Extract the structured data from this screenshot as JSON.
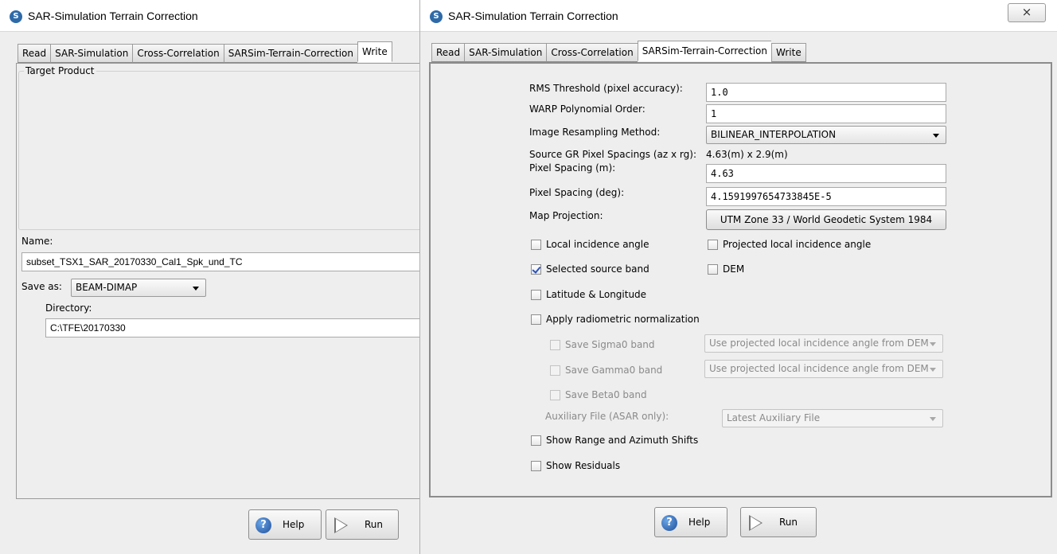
{
  "left_window": {
    "title": "SAR-Simulation Terrain Correction",
    "tabs": [
      "Read",
      "SAR-Simulation",
      "Cross-Correlation",
      "SARSim-Terrain-Correction",
      "Write"
    ],
    "active_tab": "Write",
    "group_title": "Target Product",
    "name_label": "Name:",
    "name_value": "subset_TSX1_SAR_20170330_Cal1_Spk_und_TC",
    "save_as_label": "Save as:",
    "save_as_value": "BEAM-DIMAP",
    "directory_label": "Directory:",
    "directory_value": "C:\\TFE\\20170330",
    "help_label": "Help",
    "run_label": "Run"
  },
  "right_window": {
    "title": "SAR-Simulation Terrain Correction",
    "close_label": "⨯",
    "tabs": [
      "Read",
      "SAR-Simulation",
      "Cross-Correlation",
      "SARSim-Terrain-Correction",
      "Write"
    ],
    "active_tab": "SARSim-Terrain-Correction",
    "rms_label": "RMS Threshold (pixel accuracy):",
    "rms_value": "1.0",
    "warp_label": "WARP Polynomial Order:",
    "warp_value": "1",
    "resampling_label": "Image Resampling Method:",
    "resampling_value": "BILINEAR_INTERPOLATION",
    "source_gr_label": "Source GR Pixel Spacings (az x rg):",
    "source_gr_value": "4.63(m) x 2.9(m)",
    "pixel_spacing_m_label": "Pixel Spacing (m):",
    "pixel_spacing_m_value": "4.63",
    "pixel_spacing_deg_label": "Pixel Spacing (deg):",
    "pixel_spacing_deg_value": "4.1591997654733845E-5",
    "map_projection_label": "Map Projection:",
    "map_projection_value": "UTM Zone 33 / World Geodetic System 1984",
    "checks": {
      "local_incidence": {
        "label": "Local incidence angle",
        "checked": false
      },
      "projected_local_incidence": {
        "label": "Projected local incidence angle",
        "checked": false
      },
      "selected_source_band": {
        "label": "Selected source band",
        "checked": true
      },
      "dem": {
        "label": "DEM",
        "checked": false
      },
      "lat_lon": {
        "label": "Latitude & Longitude",
        "checked": false
      },
      "radiometric": {
        "label": "Apply radiometric normalization",
        "checked": false
      },
      "sigma0": {
        "label": "Save Sigma0 band",
        "checked": false
      },
      "gamma0": {
        "label": "Save Gamma0 band",
        "checked": false
      },
      "beta0": {
        "label": "Save Beta0 band",
        "checked": false
      },
      "range_azimuth": {
        "label": "Show Range and Azimuth Shifts",
        "checked": false
      },
      "residuals": {
        "label": "Show Residuals",
        "checked": false
      }
    },
    "sigma0_option": "Use projected local incidence angle from DEM",
    "gamma0_option": "Use projected local incidence angle from DEM",
    "aux_label": "Auxiliary File (ASAR only):",
    "aux_value": "Latest Auxiliary File",
    "help_label": "Help",
    "run_label": "Run"
  }
}
